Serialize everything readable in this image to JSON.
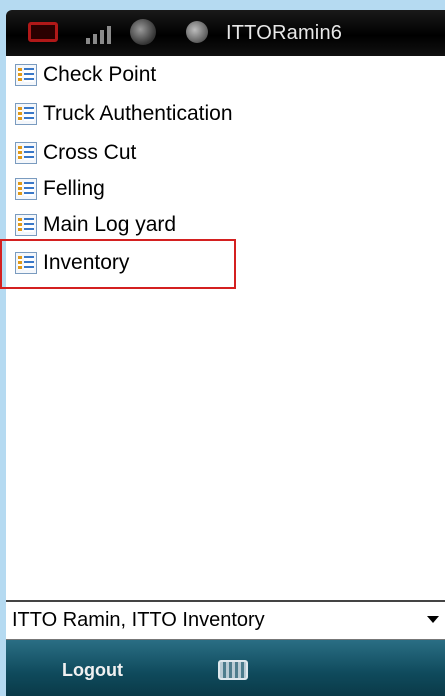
{
  "statusbar": {
    "title": "ITTORamin6",
    "icons": [
      "windows-start-icon",
      "signal-icon",
      "globe-icon",
      "sync-icon"
    ]
  },
  "menu": {
    "items": [
      {
        "label": "Check Point",
        "icon": "list-icon"
      },
      {
        "label": "Truck Authentication",
        "icon": "list-icon"
      },
      {
        "label": "Cross Cut",
        "icon": "list-icon"
      },
      {
        "label": "Felling",
        "icon": "list-icon"
      },
      {
        "label": "Main Log yard",
        "icon": "list-icon"
      },
      {
        "label": "Inventory",
        "icon": "list-icon",
        "highlighted": true
      }
    ]
  },
  "dropdown": {
    "selected": "ITTO Ramin, ITTO Inventory"
  },
  "softkeys": {
    "left_label": "Logout",
    "center_icon": "keyboard-icon"
  },
  "colors": {
    "highlight": "#d42020",
    "softkey_bar": "#0f4a5c",
    "background": "#b5daf1"
  }
}
